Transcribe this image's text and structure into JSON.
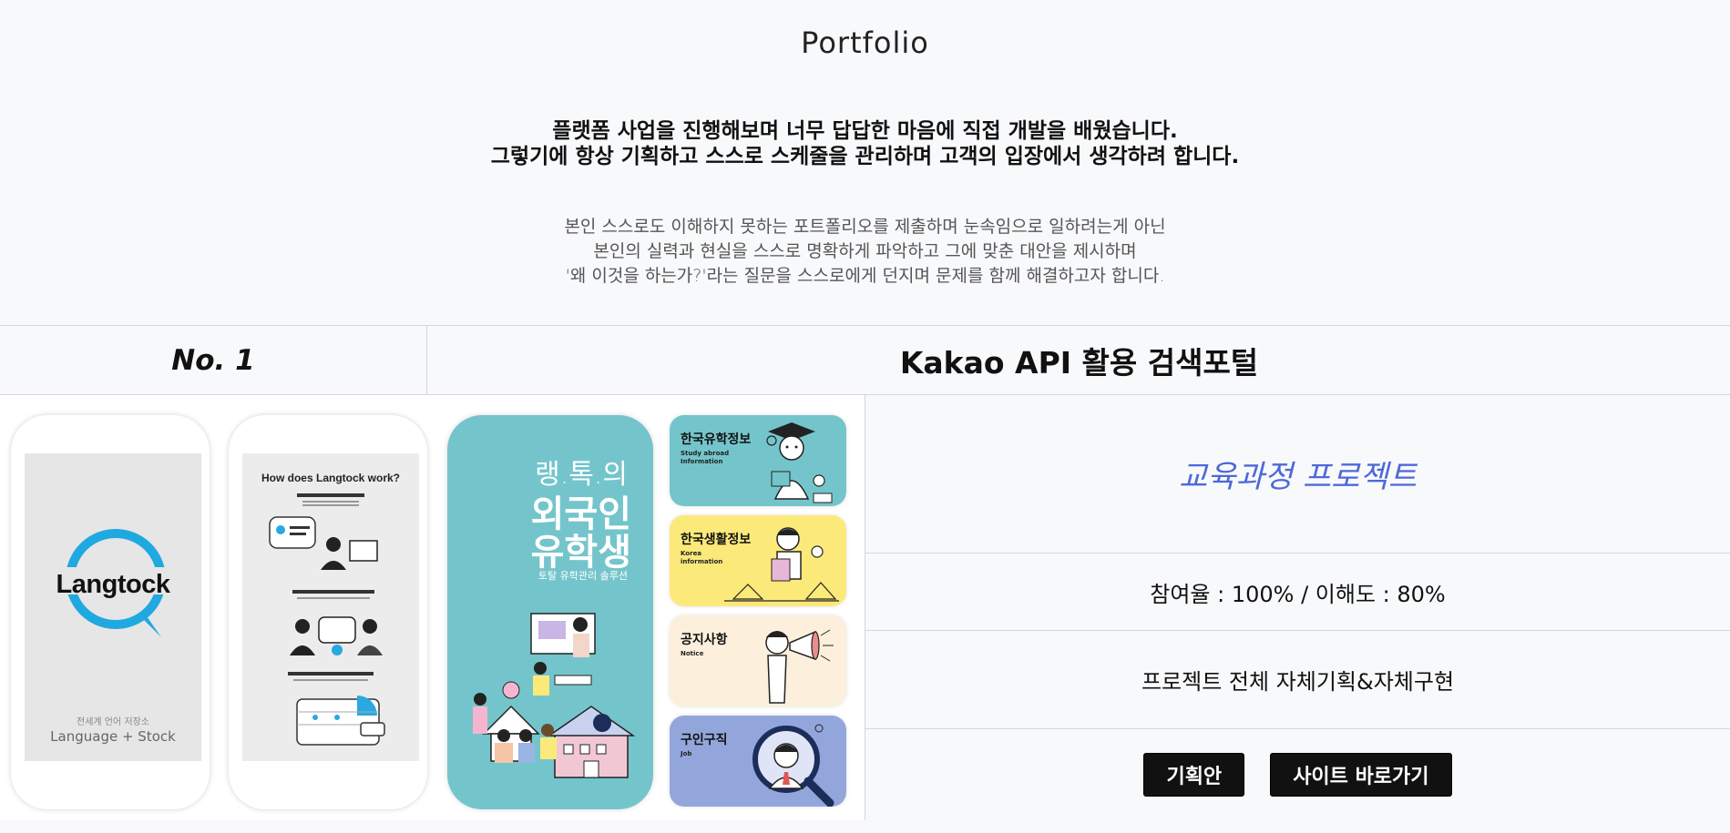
{
  "header": {
    "title": "Portfolio"
  },
  "intro": {
    "strong_lines": [
      "플랫폼 사업을 진행해보며 너무 답답한 마음에 직접 개발을 배웠습니다.",
      "그렇기에 항상 기획하고 스스로 스케줄을 관리하며 고객의 입장에서 생각하려 합니다."
    ],
    "light_lines": [
      "본인 스스로도 이해하지 못하는 포트폴리오를 제출하며 눈속임으로 일하려는게 아닌",
      "본인의 실력과 현실을 스스로 명확하게 파악하고 그에 맞춘 대안을 제시하며",
      "'왜 이것을 하는가?'라는 질문을 스스로에게 던지며 문제를 함께 해결하고자 합니다."
    ]
  },
  "project": {
    "number": "No. 1",
    "name": "Kakao API 활용 검색포털",
    "course": "교육과정 프로젝트",
    "stats": "참여율 : 100% / 이해도 : 80%",
    "scope": "프로젝트 전체 자체기획&자체구현",
    "buttons": {
      "plan": "기획안",
      "site": "사이트 바로가기"
    }
  },
  "gallery": {
    "phone1": {
      "logo": "Langtock",
      "tagline": "전세계 언어 저장소",
      "caption": "Language + Stock"
    },
    "phone2": {
      "heading": "How does Langtock work?"
    },
    "poster": {
      "line1": "랭.톡.의",
      "line2": "외국인",
      "line3": "유학생",
      "line4": "토탈 유학관리 솔루션"
    },
    "tiles": [
      {
        "title": "한국유학정보",
        "sub": "Study abroad Information",
        "color": "#74c5cb"
      },
      {
        "title": "한국생활정보",
        "sub": "Korea information",
        "color": "#fbe97a"
      },
      {
        "title": "공지사항",
        "sub": "Notice",
        "color": "#fcf0dc"
      },
      {
        "title": "구인구직",
        "sub": "Job",
        "color": "#93a6dc"
      }
    ]
  },
  "colors": {
    "accent": "#4f68d8",
    "button_bg": "#111111",
    "teal": "#74c5cb"
  }
}
